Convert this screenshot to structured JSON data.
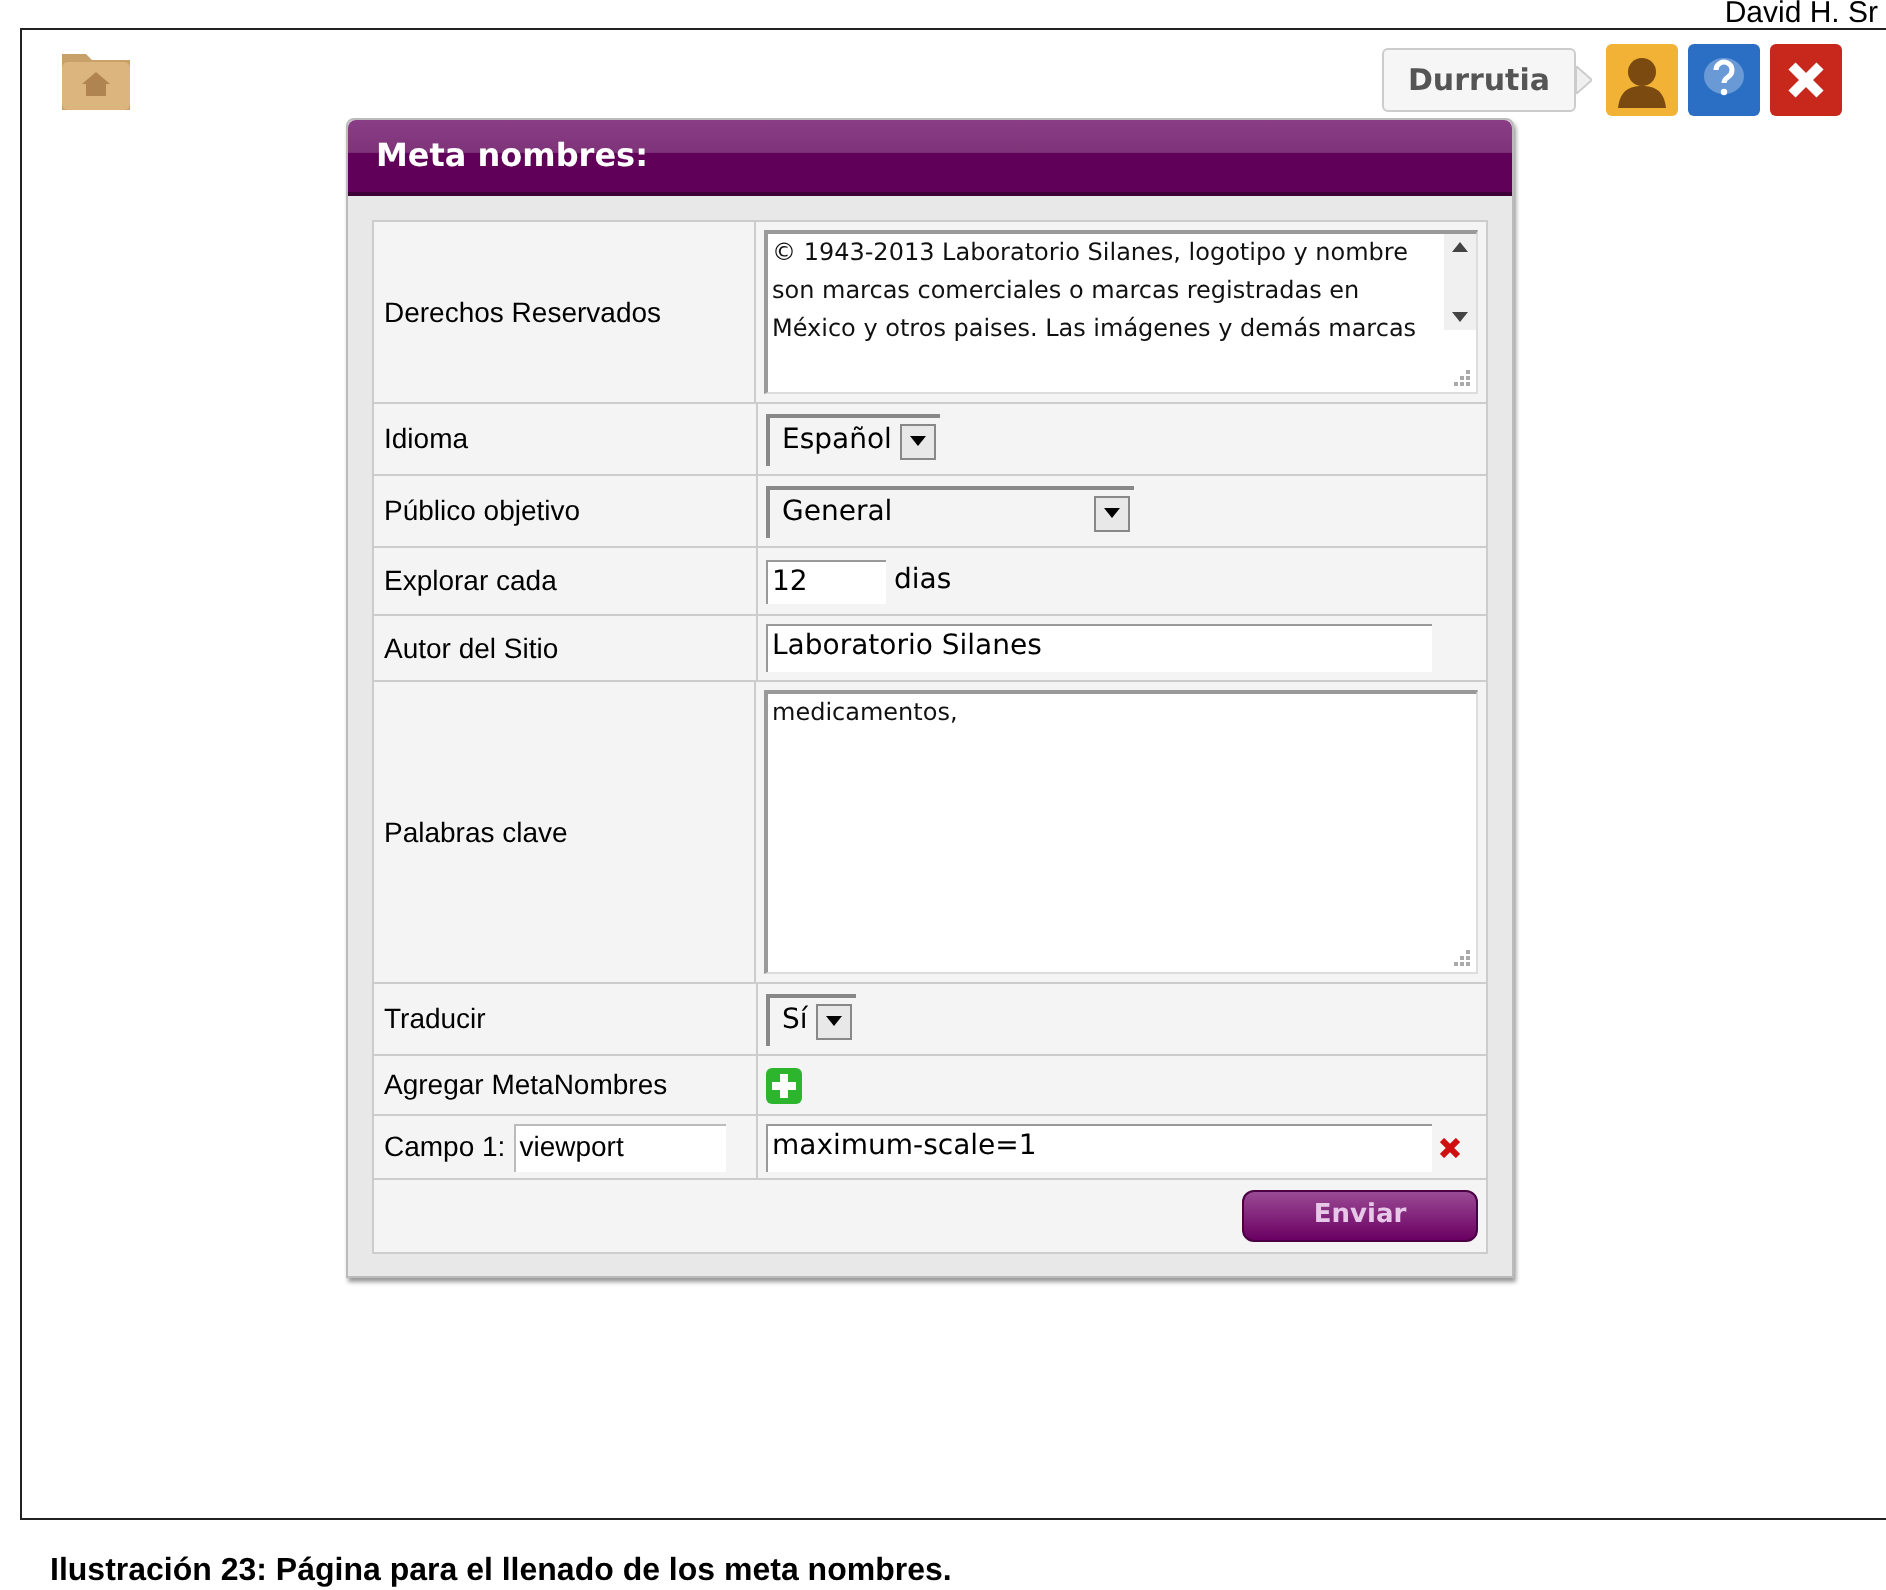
{
  "document_header": "David H. Sr",
  "toolbar": {
    "user_name": "Durrutia"
  },
  "panel": {
    "title": "Meta nombres:",
    "rows": [
      {
        "kind": "textarea",
        "label": "Derechos Reservados",
        "value": "© 1943-2013 Laboratorio Silanes, logotipo y nombre son marcas comerciales o marcas registradas en México y otros paises. Las imágenes y demás marcas",
        "scrollbar": true
      },
      {
        "kind": "select",
        "label": "Idioma",
        "value": "Español"
      },
      {
        "kind": "wide_select",
        "label": "Público objetivo",
        "value": "General"
      },
      {
        "kind": "number",
        "label": "Explorar cada",
        "value": "12",
        "unit": "dias"
      },
      {
        "kind": "text",
        "label": "Autor del Sitio",
        "value": "Laboratorio Silanes"
      },
      {
        "kind": "textarea",
        "label": "Palabras clave",
        "value": "medicamentos,",
        "scrollbar": false
      },
      {
        "kind": "select",
        "label": "Traducir",
        "value": "Sí"
      },
      {
        "kind": "add",
        "label": "Agregar MetaNombres"
      },
      {
        "kind": "pair",
        "label": "Campo 1:",
        "name_value": "viewport",
        "value": "maximum-scale=1"
      }
    ],
    "submit": "Enviar"
  },
  "caption": "Ilustración 23: Página para el llenado de los meta nombres."
}
